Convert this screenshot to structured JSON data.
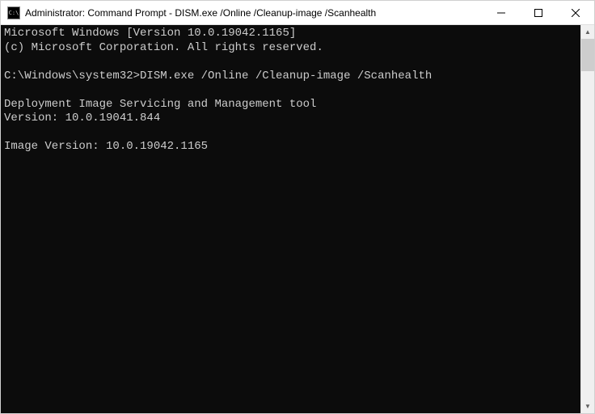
{
  "titlebar": {
    "icon_label": "C:\\",
    "title": "Administrator: Command Prompt - DISM.exe  /Online /Cleanup-image /Scanhealth"
  },
  "window_controls": {
    "minimize": "minimize",
    "maximize": "maximize",
    "close": "close"
  },
  "console": {
    "line1": "Microsoft Windows [Version 10.0.19042.1165]",
    "line2": "(c) Microsoft Corporation. All rights reserved.",
    "blank1": "",
    "prompt_line": "C:\\Windows\\system32>DISM.exe /Online /Cleanup-image /Scanhealth",
    "blank2": "",
    "tool_line": "Deployment Image Servicing and Management tool",
    "version_line": "Version: 10.0.19041.844",
    "blank3": "",
    "image_version_line": "Image Version: 10.0.19042.1165"
  }
}
